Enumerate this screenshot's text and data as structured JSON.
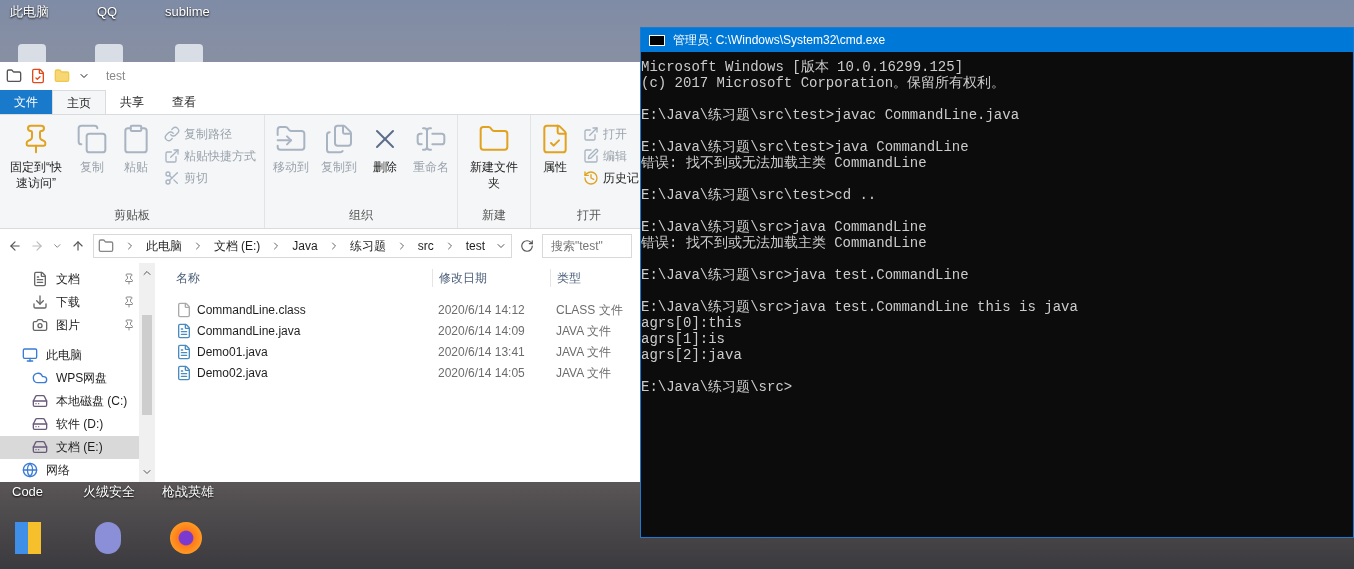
{
  "desktop": {
    "top_labels": [
      "此电脑",
      "QQ",
      "sublime"
    ],
    "bottom_labels": [
      "Code",
      "火绒安全",
      "枪战英雄"
    ]
  },
  "explorer": {
    "title": "test",
    "tabs": [
      {
        "label": "文件",
        "kind": "file",
        "selected": false
      },
      {
        "label": "主页",
        "kind": "tab",
        "selected": true
      },
      {
        "label": "共享",
        "kind": "tab",
        "selected": false
      },
      {
        "label": "查看",
        "kind": "tab",
        "selected": false
      }
    ],
    "ribbon": [
      {
        "label": "剪贴板",
        "items": [
          {
            "kind": "large",
            "label": "固定到“快速访问”",
            "disabled": false
          },
          {
            "kind": "large",
            "label": "复制",
            "disabled": true
          },
          {
            "kind": "large",
            "label": "粘贴",
            "disabled": true
          },
          {
            "kind": "small",
            "label": "复制路径",
            "disabled": true
          },
          {
            "kind": "small",
            "label": "粘贴快捷方式",
            "disabled": true
          },
          {
            "kind": "small",
            "label": "剪切",
            "disabled": true
          }
        ]
      },
      {
        "label": "组织",
        "items": [
          {
            "kind": "large",
            "label": "移动到",
            "disabled": true
          },
          {
            "kind": "large",
            "label": "复制到",
            "disabled": true
          },
          {
            "kind": "large",
            "label": "删除",
            "disabled": false
          },
          {
            "kind": "large",
            "label": "重命名",
            "disabled": true
          }
        ]
      },
      {
        "label": "新建",
        "items": [
          {
            "kind": "large",
            "label": "新建文件夹",
            "disabled": false
          }
        ]
      },
      {
        "label": "打开",
        "items": [
          {
            "kind": "large",
            "label": "属性",
            "disabled": false
          },
          {
            "kind": "small",
            "label": "打开",
            "disabled": true
          },
          {
            "kind": "small",
            "label": "编辑",
            "disabled": true
          },
          {
            "kind": "small",
            "label": "历史记",
            "disabled": false
          }
        ]
      }
    ],
    "breadcrumb": [
      "此电脑",
      "文档 (E:)",
      "Java",
      "练习题",
      "src",
      "test"
    ],
    "search": {
      "placeholder": "搜索\"test\""
    },
    "quick_access": [
      {
        "label": "文档",
        "pinned": true
      },
      {
        "label": "下载",
        "pinned": true
      },
      {
        "label": "图片",
        "pinned": true
      }
    ],
    "tree": [
      {
        "label": "此电脑",
        "selected": false,
        "children": [
          {
            "label": "WPS网盘",
            "selected": false
          },
          {
            "label": "本地磁盘 (C:)",
            "selected": false
          },
          {
            "label": "软件 (D:)",
            "selected": false
          },
          {
            "label": "文档 (E:)",
            "selected": true
          }
        ]
      },
      {
        "label": "网络",
        "selected": false
      }
    ],
    "columns": [
      "名称",
      "修改日期",
      "类型"
    ],
    "files": [
      {
        "name": "CommandLine.class",
        "date": "2020/6/14 14:12",
        "type": "CLASS 文件",
        "kind": "class"
      },
      {
        "name": "CommandLine.java",
        "date": "2020/6/14 14:09",
        "type": "JAVA 文件",
        "kind": "java"
      },
      {
        "name": "Demo01.java",
        "date": "2020/6/14 13:41",
        "type": "JAVA 文件",
        "kind": "java"
      },
      {
        "name": "Demo02.java",
        "date": "2020/6/14 14:05",
        "type": "JAVA 文件",
        "kind": "java"
      }
    ]
  },
  "cmd": {
    "title": "管理员: C:\\Windows\\System32\\cmd.exe",
    "blocks": [
      [
        "Microsoft Windows [版本 10.0.16299.125]",
        "(c) 2017 Microsoft Corporation。保留所有权利。"
      ],
      [
        "E:\\Java\\练习题\\src\\test>javac CommandLine.java"
      ],
      [
        "E:\\Java\\练习题\\src\\test>java CommandLine",
        "错误: 找不到或无法加载主类 CommandLine"
      ],
      [
        "E:\\Java\\练习题\\src\\test>cd .."
      ],
      [
        "E:\\Java\\练习题\\src>java CommandLine",
        "错误: 找不到或无法加载主类 CommandLine"
      ],
      [
        "E:\\Java\\练习题\\src>java test.CommandLine"
      ],
      [
        "E:\\Java\\练习题\\src>java test.CommandLine this is java",
        "agrs[0]:this",
        "agrs[1]:is",
        "agrs[2]:java"
      ],
      [
        "E:\\Java\\练习题\\src>"
      ]
    ]
  }
}
